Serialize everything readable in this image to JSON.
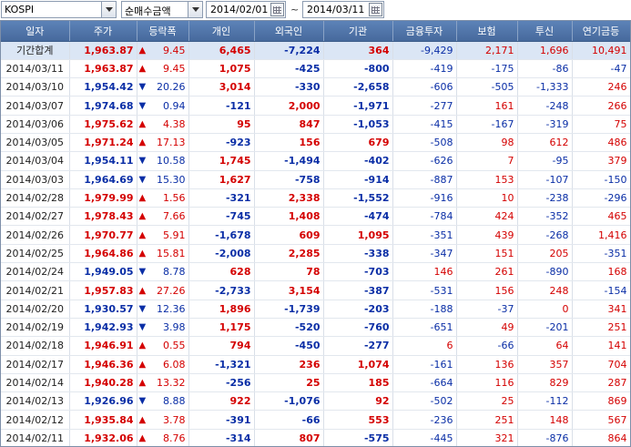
{
  "toolbar": {
    "market": "KOSPI",
    "metric": "순매수금액",
    "start_date": "2014/02/01",
    "end_date": "2014/03/11",
    "separator": "~"
  },
  "table": {
    "headers": [
      "일자",
      "주가",
      "등락폭",
      "개인",
      "외국인",
      "기관",
      "금융투자",
      "보험",
      "투신",
      "연기금등"
    ],
    "total": {
      "date": "기간합계",
      "price": "1,963.87",
      "dir": "up",
      "change": "9.45",
      "indiv": "6,465",
      "foreign": "-7,224",
      "inst": "364",
      "fin": "-9,429",
      "ins": "2,171",
      "trust": "1,696",
      "pension": "10,491"
    },
    "rows": [
      {
        "date": "2014/03/11",
        "price": "1,963.87",
        "dir": "up",
        "change": "9.45",
        "indiv": "1,075",
        "foreign": "-425",
        "inst": "-800",
        "fin": "-419",
        "ins": "-175",
        "trust": "-86",
        "pension": "-47"
      },
      {
        "date": "2014/03/10",
        "price": "1,954.42",
        "dir": "down",
        "change": "20.26",
        "indiv": "3,014",
        "foreign": "-330",
        "inst": "-2,658",
        "fin": "-606",
        "ins": "-505",
        "trust": "-1,333",
        "pension": "246"
      },
      {
        "date": "2014/03/07",
        "price": "1,974.68",
        "dir": "down",
        "change": "0.94",
        "indiv": "-121",
        "foreign": "2,000",
        "inst": "-1,971",
        "fin": "-277",
        "ins": "161",
        "trust": "-248",
        "pension": "266"
      },
      {
        "date": "2014/03/06",
        "price": "1,975.62",
        "dir": "up",
        "change": "4.38",
        "indiv": "95",
        "foreign": "847",
        "inst": "-1,053",
        "fin": "-415",
        "ins": "-167",
        "trust": "-319",
        "pension": "75"
      },
      {
        "date": "2014/03/05",
        "price": "1,971.24",
        "dir": "up",
        "change": "17.13",
        "indiv": "-923",
        "foreign": "156",
        "inst": "679",
        "fin": "-508",
        "ins": "98",
        "trust": "612",
        "pension": "486"
      },
      {
        "date": "2014/03/04",
        "price": "1,954.11",
        "dir": "down",
        "change": "10.58",
        "indiv": "1,745",
        "foreign": "-1,494",
        "inst": "-402",
        "fin": "-626",
        "ins": "7",
        "trust": "-95",
        "pension": "379"
      },
      {
        "date": "2014/03/03",
        "price": "1,964.69",
        "dir": "down",
        "change": "15.30",
        "indiv": "1,627",
        "foreign": "-758",
        "inst": "-914",
        "fin": "-887",
        "ins": "153",
        "trust": "-107",
        "pension": "-150"
      },
      {
        "date": "2014/02/28",
        "price": "1,979.99",
        "dir": "up",
        "change": "1.56",
        "indiv": "-321",
        "foreign": "2,338",
        "inst": "-1,552",
        "fin": "-916",
        "ins": "10",
        "trust": "-238",
        "pension": "-296"
      },
      {
        "date": "2014/02/27",
        "price": "1,978.43",
        "dir": "up",
        "change": "7.66",
        "indiv": "-745",
        "foreign": "1,408",
        "inst": "-474",
        "fin": "-784",
        "ins": "424",
        "trust": "-352",
        "pension": "465"
      },
      {
        "date": "2014/02/26",
        "price": "1,970.77",
        "dir": "up",
        "change": "5.91",
        "indiv": "-1,678",
        "foreign": "609",
        "inst": "1,095",
        "fin": "-351",
        "ins": "439",
        "trust": "-268",
        "pension": "1,416"
      },
      {
        "date": "2014/02/25",
        "price": "1,964.86",
        "dir": "up",
        "change": "15.81",
        "indiv": "-2,008",
        "foreign": "2,285",
        "inst": "-338",
        "fin": "-347",
        "ins": "151",
        "trust": "205",
        "pension": "-351"
      },
      {
        "date": "2014/02/24",
        "price": "1,949.05",
        "dir": "down",
        "change": "8.78",
        "indiv": "628",
        "foreign": "78",
        "inst": "-703",
        "fin": "146",
        "ins": "261",
        "trust": "-890",
        "pension": "168"
      },
      {
        "date": "2014/02/21",
        "price": "1,957.83",
        "dir": "up",
        "change": "27.26",
        "indiv": "-2,733",
        "foreign": "3,154",
        "inst": "-387",
        "fin": "-531",
        "ins": "156",
        "trust": "248",
        "pension": "-154"
      },
      {
        "date": "2014/02/20",
        "price": "1,930.57",
        "dir": "down",
        "change": "12.36",
        "indiv": "1,896",
        "foreign": "-1,739",
        "inst": "-203",
        "fin": "-188",
        "ins": "-37",
        "trust": "0",
        "pension": "341"
      },
      {
        "date": "2014/02/19",
        "price": "1,942.93",
        "dir": "down",
        "change": "3.98",
        "indiv": "1,175",
        "foreign": "-520",
        "inst": "-760",
        "fin": "-651",
        "ins": "49",
        "trust": "-201",
        "pension": "251"
      },
      {
        "date": "2014/02/18",
        "price": "1,946.91",
        "dir": "up",
        "change": "0.55",
        "indiv": "794",
        "foreign": "-450",
        "inst": "-277",
        "fin": "6",
        "ins": "-66",
        "trust": "64",
        "pension": "141"
      },
      {
        "date": "2014/02/17",
        "price": "1,946.36",
        "dir": "up",
        "change": "6.08",
        "indiv": "-1,321",
        "foreign": "236",
        "inst": "1,074",
        "fin": "-161",
        "ins": "136",
        "trust": "357",
        "pension": "704"
      },
      {
        "date": "2014/02/14",
        "price": "1,940.28",
        "dir": "up",
        "change": "13.32",
        "indiv": "-256",
        "foreign": "25",
        "inst": "185",
        "fin": "-664",
        "ins": "116",
        "trust": "829",
        "pension": "287"
      },
      {
        "date": "2014/02/13",
        "price": "1,926.96",
        "dir": "down",
        "change": "8.88",
        "indiv": "922",
        "foreign": "-1,076",
        "inst": "92",
        "fin": "-502",
        "ins": "25",
        "trust": "-112",
        "pension": "869"
      },
      {
        "date": "2014/02/12",
        "price": "1,935.84",
        "dir": "up",
        "change": "3.78",
        "indiv": "-391",
        "foreign": "-66",
        "inst": "553",
        "fin": "-236",
        "ins": "251",
        "trust": "148",
        "pension": "567"
      },
      {
        "date": "2014/02/11",
        "price": "1,932.06",
        "dir": "up",
        "change": "8.76",
        "indiv": "-314",
        "foreign": "807",
        "inst": "-575",
        "fin": "-445",
        "ins": "321",
        "trust": "-876",
        "pension": "864"
      }
    ]
  },
  "icons": {
    "up": "▲",
    "down": "▼"
  },
  "colors": {
    "positive": "#d40000",
    "negative": "#0a2ea6",
    "header": "#4f74a8",
    "total_row": "#dbe6f5"
  }
}
